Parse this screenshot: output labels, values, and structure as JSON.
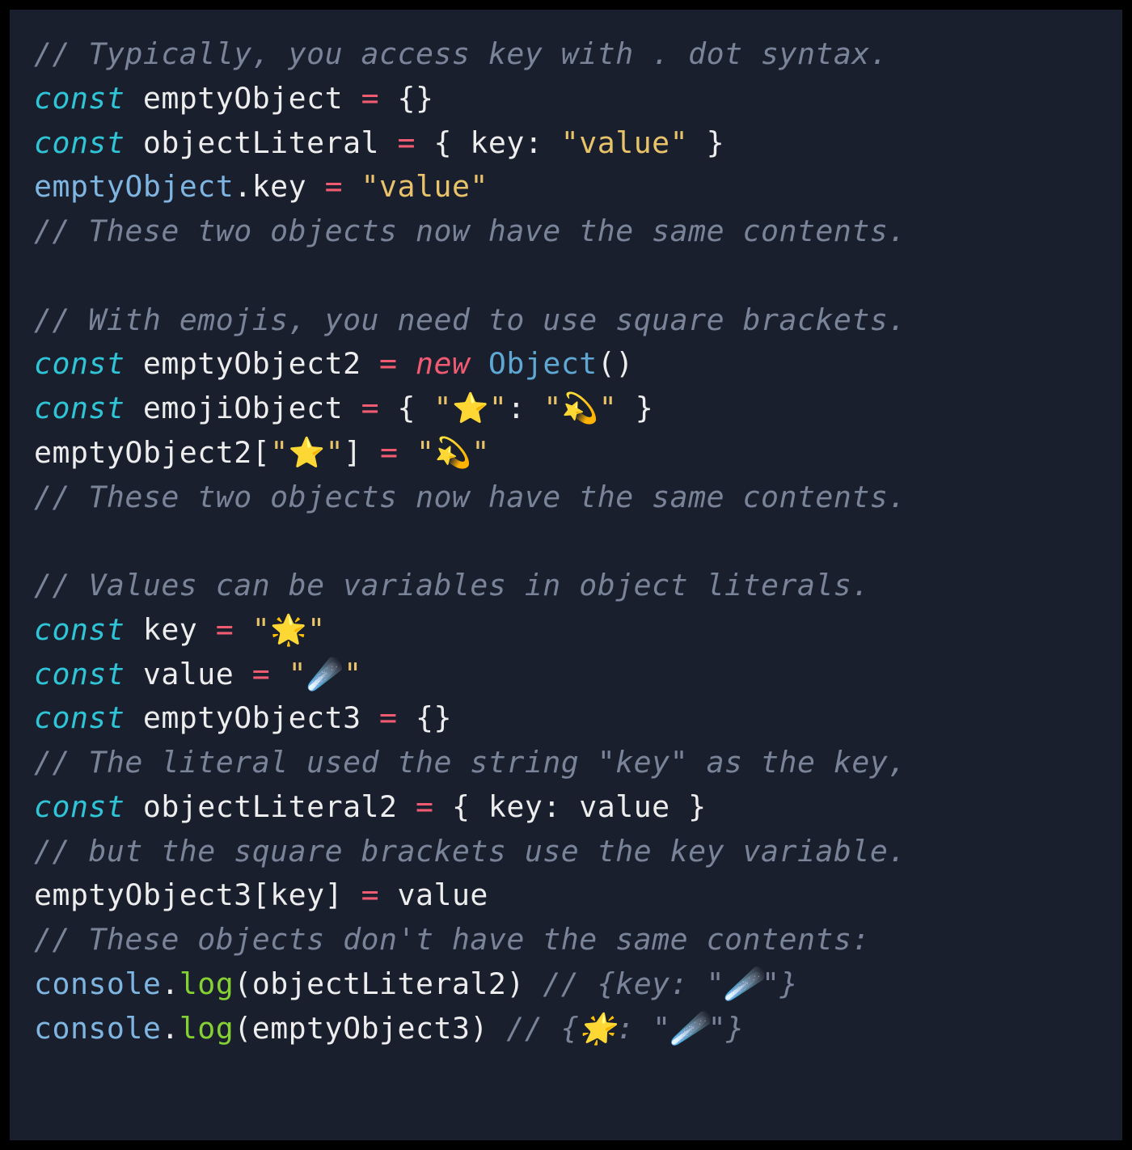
{
  "colors": {
    "bg": "#1a1f2e",
    "comment": "#7a8499",
    "keyword": "#2fc4d6",
    "operator": "#f05b72",
    "string": "#e8c36a",
    "class": "#5fa8d3",
    "variable": "#7fb5e1",
    "method": "#85d134",
    "text": "#ededed"
  },
  "lines": {
    "c1": "// Typically, you access key with . dot syntax.",
    "l2_const": "const",
    "l2_rest": " emptyObject ",
    "l2_eq": "=",
    "l2_end": " {}",
    "l3_const": "const",
    "l3_rest": " objectLiteral ",
    "l3_eq": "=",
    "l3_mid": " { key: ",
    "l3_str": "\"value\"",
    "l3_end": " }",
    "l4_var": "emptyObject",
    "l4_mid": ".key ",
    "l4_eq": "=",
    "l4_sp": " ",
    "l4_str": "\"value\"",
    "c5": "// These two objects now have the same contents.",
    "c7": "// With emojis, you need to use square brackets.",
    "l8_const": "const",
    "l8_rest": " emptyObject2 ",
    "l8_eq": "=",
    "l8_sp": " ",
    "l8_new": "new",
    "l8_sp2": " ",
    "l8_class": "Object",
    "l8_end": "()",
    "l9_const": "const",
    "l9_rest": " emojiObject ",
    "l9_eq": "=",
    "l9_mid": " { ",
    "l9_str1": "\"⭐\"",
    "l9_colon": ": ",
    "l9_str2": "\"💫\"",
    "l9_end": " }",
    "l10_ident": "emptyObject2[",
    "l10_str1": "\"⭐\"",
    "l10_br": "] ",
    "l10_eq": "=",
    "l10_sp": " ",
    "l10_str2": "\"💫\"",
    "c11": "// These two objects now have the same contents.",
    "c13": "// Values can be variables in object literals.",
    "l14_const": "const",
    "l14_rest": " key ",
    "l14_eq": "=",
    "l14_sp": " ",
    "l14_str": "\"🌟\"",
    "l15_const": "const",
    "l15_rest": " value ",
    "l15_eq": "=",
    "l15_sp": " ",
    "l15_str": "\"☄️\"",
    "l16_const": "const",
    "l16_rest": " emptyObject3 ",
    "l16_eq": "=",
    "l16_end": " {}",
    "c17": "// The literal used the string \"key\" as the key,",
    "l18_const": "const",
    "l18_rest": " objectLiteral2 ",
    "l18_eq": "=",
    "l18_end": " { key: value }",
    "c19": "// but the square brackets use the key variable.",
    "l20_ident": "emptyObject3[key] ",
    "l20_eq": "=",
    "l20_end": " value",
    "c21": "// These objects don't have the same contents:",
    "l22_var": "console",
    "l22_dot": ".",
    "l22_method": "log",
    "l22_arg": "(objectLiteral2) ",
    "l22_cmt": "// {key: \"☄️\"}",
    "l23_var": "console",
    "l23_dot": ".",
    "l23_method": "log",
    "l23_arg": "(emptyObject3) ",
    "l23_cmt": "// {🌟: \"☄️\"}"
  }
}
